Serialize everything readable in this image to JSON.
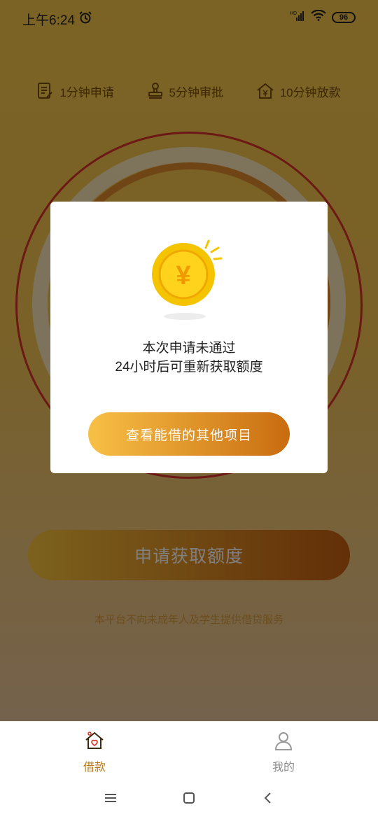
{
  "status_bar": {
    "time": "上午6:24",
    "network": "HD",
    "battery": "96"
  },
  "features": [
    {
      "label": "1分钟申请",
      "icon": "document-edit-icon"
    },
    {
      "label": "5分钟审批",
      "icon": "stamp-icon"
    },
    {
      "label": "10分钟放款",
      "icon": "house-yen-icon"
    }
  ],
  "main": {
    "apply_button": "申请获取额度",
    "disclaimer": "本平台不向未成年人及学生提供借贷服务"
  },
  "modal": {
    "icon": "yen-coin-icon",
    "coin_symbol": "¥",
    "line1": "本次申请未通过",
    "line2": "24小时后可重新获取额度",
    "button": "查看能借的其他项目"
  },
  "bottom_nav": {
    "items": [
      {
        "label": "借款",
        "icon": "house-icon",
        "active": true
      },
      {
        "label": "我的",
        "icon": "user-icon",
        "active": false
      }
    ]
  },
  "colors": {
    "accent": "#b5791b",
    "button_start": "#f8c046",
    "button_end": "#c86c10",
    "ring": "#d9332a"
  }
}
